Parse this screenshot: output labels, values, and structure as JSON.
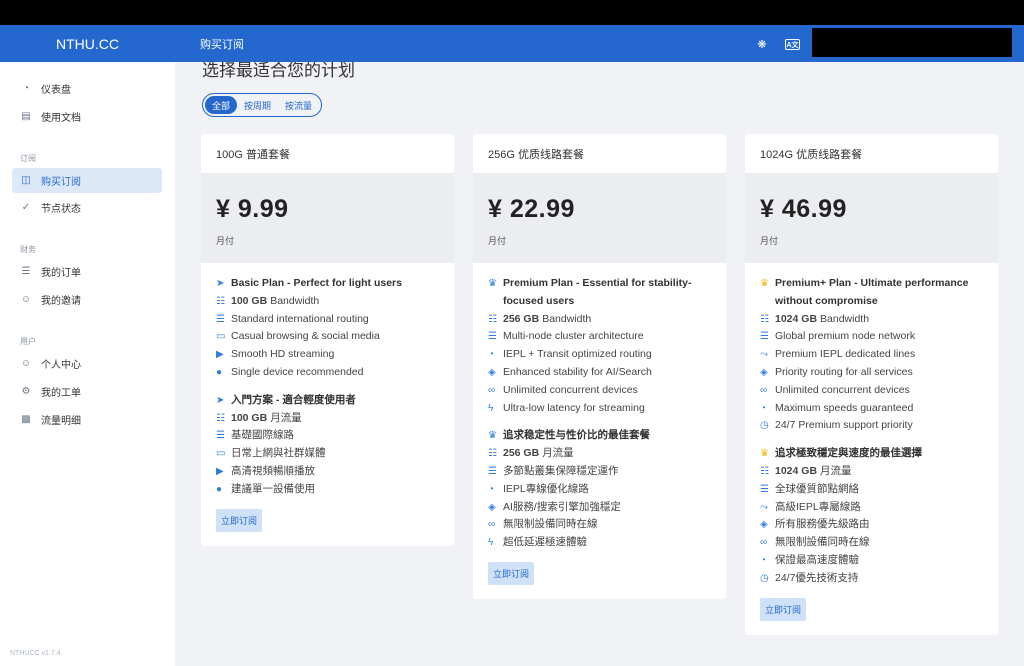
{
  "brand": "NTHU.CC",
  "header": {
    "title": "购买订阅"
  },
  "sidebar": {
    "items_top": [
      {
        "label": "仪表盘",
        "icon": "dashboard-icon"
      },
      {
        "label": "使用文档",
        "icon": "book-icon"
      }
    ],
    "sections": [
      {
        "title": "订阅",
        "items": [
          {
            "label": "购买订阅",
            "icon": "shopping-bag-icon",
            "active": true
          },
          {
            "label": "节点状态",
            "icon": "check-circle-icon"
          }
        ]
      },
      {
        "title": "财务",
        "items": [
          {
            "label": "我的订单",
            "icon": "list-icon"
          },
          {
            "label": "我的邀请",
            "icon": "users-icon"
          }
        ]
      },
      {
        "title": "用户",
        "items": [
          {
            "label": "个人中心",
            "icon": "user-icon"
          },
          {
            "label": "我的工单",
            "icon": "ticket-icon"
          },
          {
            "label": "流量明细",
            "icon": "chart-icon"
          }
        ]
      }
    ],
    "version": "NTHUCC v1.7.4"
  },
  "main": {
    "heading": "选择最适合您的计划",
    "filters": [
      "全部",
      "按周期",
      "按流量"
    ],
    "active_filter": "全部",
    "buy_label": "立即订阅",
    "cards": [
      {
        "title": "100G 普通套餐",
        "price": "¥ 9.99",
        "period": "月付",
        "features": [
          {
            "icon": "plane-icon",
            "text": "Basic Plan - Perfect for light users",
            "head": true
          },
          {
            "icon": "network-icon",
            "bold": "100 GB",
            "text": "Bandwidth"
          },
          {
            "icon": "server-icon",
            "text": "Standard international routing"
          },
          {
            "icon": "laptop-icon",
            "text": "Casual browsing & social media"
          },
          {
            "icon": "play-icon",
            "text": "Smooth HD streaming"
          },
          {
            "icon": "user-icon",
            "text": "Single device recommended"
          },
          {
            "gap": true
          },
          {
            "icon": "plane-icon",
            "text": "入門方案 - 適合輕度使用者",
            "head": true
          },
          {
            "icon": "network-icon",
            "bold": "100 GB",
            "text": "月流量"
          },
          {
            "icon": "server-icon",
            "text": "基礎國際線路"
          },
          {
            "icon": "laptop-icon",
            "text": "日常上網與社群媒體"
          },
          {
            "icon": "play-icon",
            "text": "高清視頻暢順播放"
          },
          {
            "icon": "user-icon",
            "text": "建議單一設備使用"
          }
        ]
      },
      {
        "title": "256G 优质线路套餐",
        "price": "¥ 22.99",
        "period": "月付",
        "features": [
          {
            "icon": "crown-icon",
            "text": "Premium Plan - Essential for stability-focused users",
            "head": true
          },
          {
            "icon": "network-icon",
            "bold": "256 GB",
            "text": "Bandwidth"
          },
          {
            "icon": "server-icon",
            "text": "Multi-node cluster architecture"
          },
          {
            "icon": "gauge-icon",
            "text": "IEPL + Transit optimized routing"
          },
          {
            "icon": "shield-icon",
            "text": "Enhanced stability for AI/Search"
          },
          {
            "icon": "infinity-icon",
            "text": "Unlimited concurrent devices"
          },
          {
            "icon": "bolt-icon",
            "text": "Ultra-low latency for streaming"
          },
          {
            "gap": true
          },
          {
            "icon": "crown-icon",
            "text": "追求稳定性与性价比的最佳套餐",
            "head": true
          },
          {
            "icon": "network-icon",
            "bold": "256 GB",
            "text": "月流量"
          },
          {
            "icon": "server-icon",
            "text": "多節點叢集保障穩定運作"
          },
          {
            "icon": "gauge-icon",
            "text": "IEPL專線優化線路"
          },
          {
            "icon": "shield-icon",
            "text": "AI服務/搜索引擎加強穩定"
          },
          {
            "icon": "infinity-icon",
            "text": "無限制設備同時在線"
          },
          {
            "icon": "bolt-icon",
            "text": "超低延遲極速體驗"
          }
        ]
      },
      {
        "title": "1024G 优质线路套餐",
        "price": "¥ 46.99",
        "period": "月付",
        "features": [
          {
            "icon": "gold-crown-icon",
            "text": "Premium+ Plan - Ultimate performance without compromise",
            "head": true
          },
          {
            "icon": "network-icon",
            "bold": "1024 GB",
            "text": "Bandwidth"
          },
          {
            "icon": "server-icon",
            "text": "Global premium node network"
          },
          {
            "icon": "route-icon",
            "text": "Premium IEPL dedicated lines"
          },
          {
            "icon": "shield-icon",
            "text": "Priority routing for all services"
          },
          {
            "icon": "infinity-icon",
            "text": "Unlimited concurrent devices"
          },
          {
            "icon": "gauge-icon",
            "text": "Maximum speeds guaranteed"
          },
          {
            "icon": "clock-icon",
            "text": "24/7 Premium support priority"
          },
          {
            "gap": true
          },
          {
            "icon": "gold-crown-icon",
            "text": "追求極致穩定與速度的最佳選擇",
            "head": true
          },
          {
            "icon": "network-icon",
            "bold": "1024 GB",
            "text": "月流量"
          },
          {
            "icon": "server-icon",
            "text": "全球優質節點網絡"
          },
          {
            "icon": "route-icon",
            "text": "高級IEPL專屬線路"
          },
          {
            "icon": "shield-icon",
            "text": "所有服務優先級路由"
          },
          {
            "icon": "infinity-icon",
            "text": "無限制設備同時在線"
          },
          {
            "icon": "gauge-icon",
            "text": "保證最高速度體驗"
          },
          {
            "icon": "clock-icon",
            "text": "24/7優先技術支持"
          }
        ]
      }
    ]
  },
  "colors": {
    "accent": "#2468cf",
    "icon": "#2f7de1",
    "gold": "#f2b90d"
  }
}
